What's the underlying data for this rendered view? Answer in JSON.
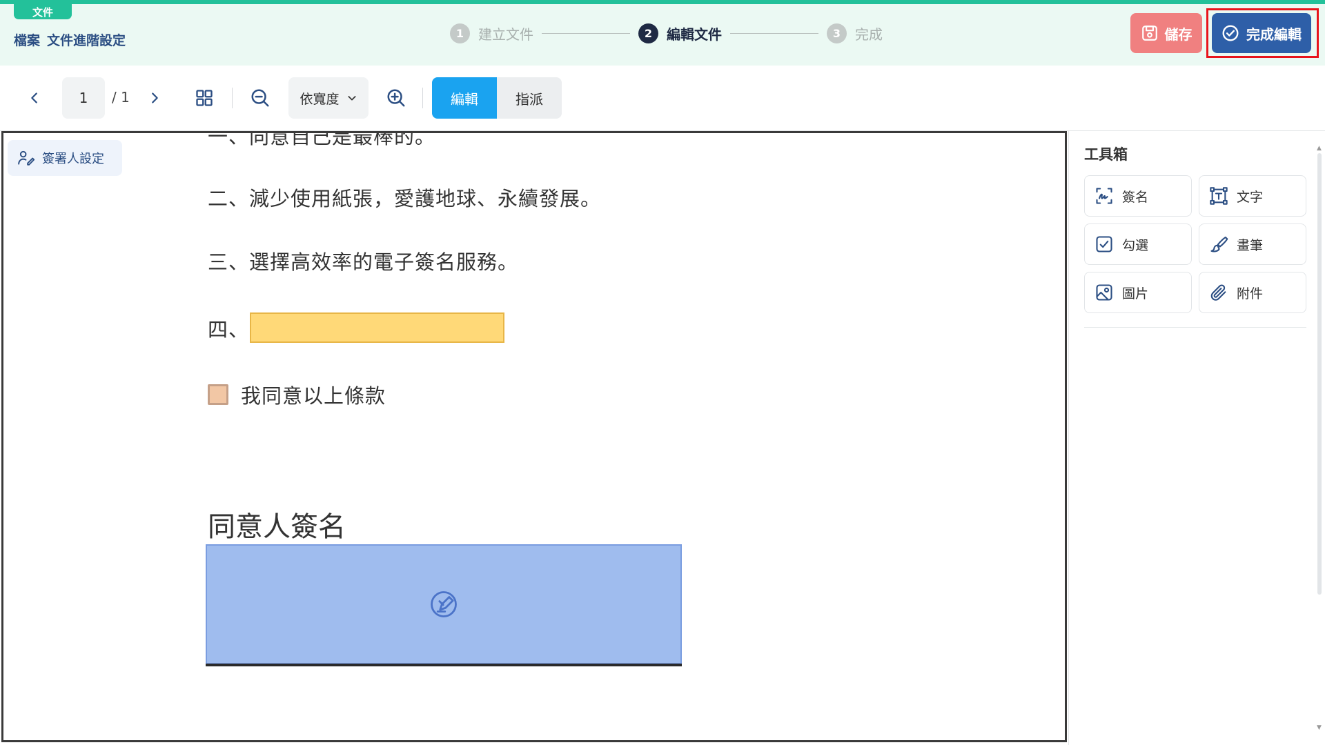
{
  "header": {
    "doc_tag": "文件",
    "breadcrumb": [
      "檔案",
      "文件進階設定"
    ],
    "steps": [
      {
        "num": "1",
        "label": "建立文件",
        "state": "done"
      },
      {
        "num": "2",
        "label": "編輯文件",
        "state": "active"
      },
      {
        "num": "3",
        "label": "完成",
        "state": "todo"
      }
    ],
    "save_label": "儲存",
    "finish_label": "完成編輯"
  },
  "toolbar": {
    "current_page": "1",
    "total_pages": "/ 1",
    "zoom_mode": "依寬度",
    "modes": [
      {
        "label": "編輯",
        "active": true
      },
      {
        "label": "指派",
        "active": false
      }
    ]
  },
  "viewer": {
    "signer_settings_label": "簽署人設定",
    "lines": [
      "一、同意自己是最棒的。",
      "二、減少使用紙張，愛護地球、永續發展。",
      "三、選擇高效率的電子簽名服務。",
      "四、"
    ],
    "checkbox_label": "我同意以上條款",
    "signature_title": "同意人簽名"
  },
  "toolbox": {
    "title": "工具箱",
    "tools": [
      {
        "label": "簽名",
        "icon": "signature-icon"
      },
      {
        "label": "文字",
        "icon": "text-frame-icon"
      },
      {
        "label": "勾選",
        "icon": "checkbox-icon"
      },
      {
        "label": "畫筆",
        "icon": "brush-icon"
      },
      {
        "label": "圖片",
        "icon": "image-icon"
      },
      {
        "label": "附件",
        "icon": "paperclip-icon"
      }
    ]
  },
  "colors": {
    "accent": "#23c19a",
    "primary": "#2e5fa8",
    "save": "#f08080",
    "edit_mode": "#1aa3f0",
    "text_field": "#ffd978",
    "signature_field": "#9fbcee",
    "annotation_red": "#e8141c"
  }
}
